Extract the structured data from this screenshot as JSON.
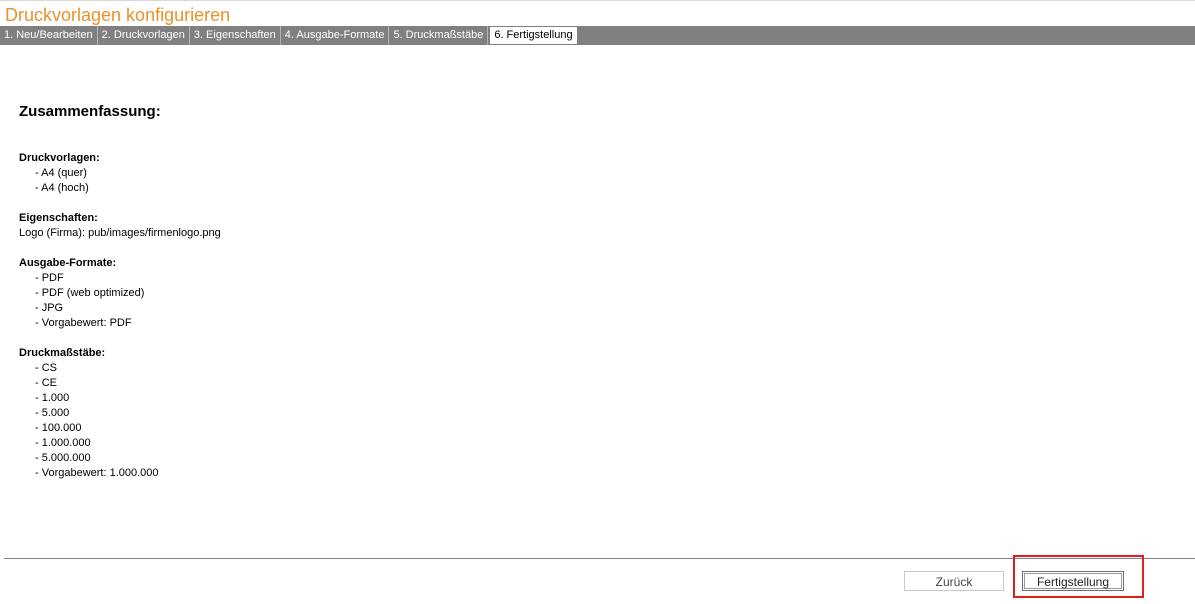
{
  "window": {
    "title": "Druckvorlagen konfigurieren",
    "accent_color": "#e8912d"
  },
  "tabs": [
    {
      "label": "1. Neu/Bearbeiten",
      "active": false
    },
    {
      "label": "2. Druckvorlagen",
      "active": false
    },
    {
      "label": "3. Eigenschaften",
      "active": false
    },
    {
      "label": "4. Ausgabe-Formate",
      "active": false
    },
    {
      "label": "5. Druckmaßstäbe",
      "active": false
    },
    {
      "label": "6. Fertigstellung",
      "active": true
    }
  ],
  "summary": {
    "heading": "Zusammenfassung:",
    "druckvorlagen": {
      "title": "Druckvorlagen:",
      "items": [
        "- A4 (quer)",
        "- A4 (hoch)"
      ]
    },
    "eigenschaften": {
      "title": "Eigenschaften:",
      "line": "Logo (Firma): pub/images/firmenlogo.png"
    },
    "ausgabe_formate": {
      "title": "Ausgabe-Formate:",
      "items": [
        "- PDF",
        "- PDF (web optimized)",
        "- JPG",
        "- Vorgabewert: PDF"
      ]
    },
    "druckmassstaebe": {
      "title": "Druckmaßstäbe:",
      "items": [
        "- CS",
        "- CE",
        "- 1.000",
        "- 5.000",
        "- 100.000",
        "- 1.000.000",
        "- 5.000.000",
        "- Vorgabewert: 1.000.000"
      ]
    }
  },
  "footer": {
    "back_label": "Zurück",
    "finish_label": "Fertigstellung",
    "highlight_color": "#e01e1e"
  }
}
